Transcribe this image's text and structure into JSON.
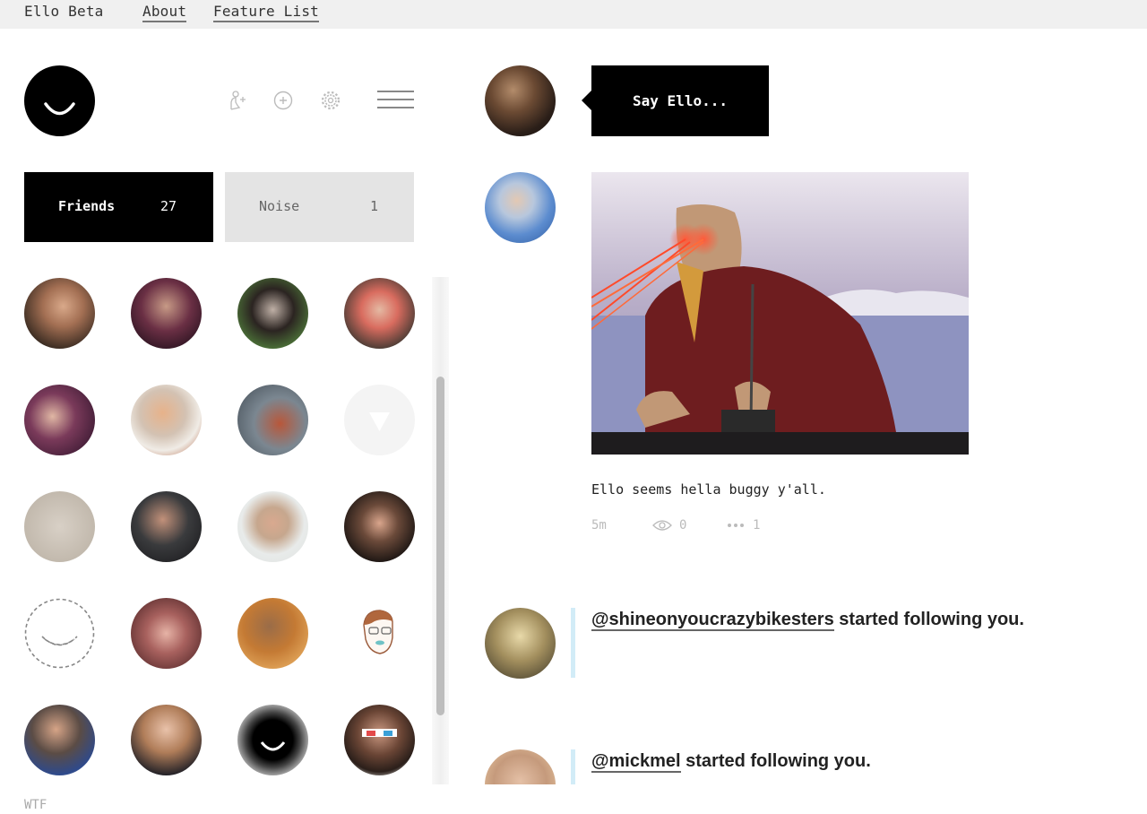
{
  "topbar": {
    "brand": "Ello Beta",
    "links": [
      "About",
      "Feature List"
    ]
  },
  "toolbar": {
    "icons": [
      "invite-user-icon",
      "add-circle-icon",
      "gear-icon",
      "hamburger-menu-icon"
    ]
  },
  "tabs": {
    "friends": {
      "label": "Friends",
      "count": "27"
    },
    "noise": {
      "label": "Noise",
      "count": "1"
    }
  },
  "friends_grid": {
    "avatars": [
      "friend-1",
      "friend-2",
      "friend-3",
      "friend-4",
      "friend-5",
      "friend-6",
      "friend-7",
      "default-avatar-triangle",
      "friend-9",
      "friend-10",
      "friend-11",
      "friend-12",
      "default-avatar-dashed-smile",
      "friend-14",
      "friend-15",
      "friend-16",
      "friend-17",
      "friend-18",
      "friend-ello-hood",
      "friend-20"
    ]
  },
  "footer": {
    "wtf_label": "WTF"
  },
  "composer": {
    "placeholder": "Say Ello..."
  },
  "post": {
    "text": "Ello seems hella buggy y'all.",
    "time": "5m",
    "views": "0",
    "comments": "1"
  },
  "notifications": [
    {
      "handle": "@shineonyoucrazybikesters",
      "action": "started following you."
    },
    {
      "handle": "@mickmel",
      "action": "started following you."
    }
  ],
  "colors": {
    "accent_black": "#000000",
    "tab_inactive": "#e4e4e4",
    "notif_bar": "#d2ecf7",
    "topbar_bg": "#f0f0f0"
  }
}
